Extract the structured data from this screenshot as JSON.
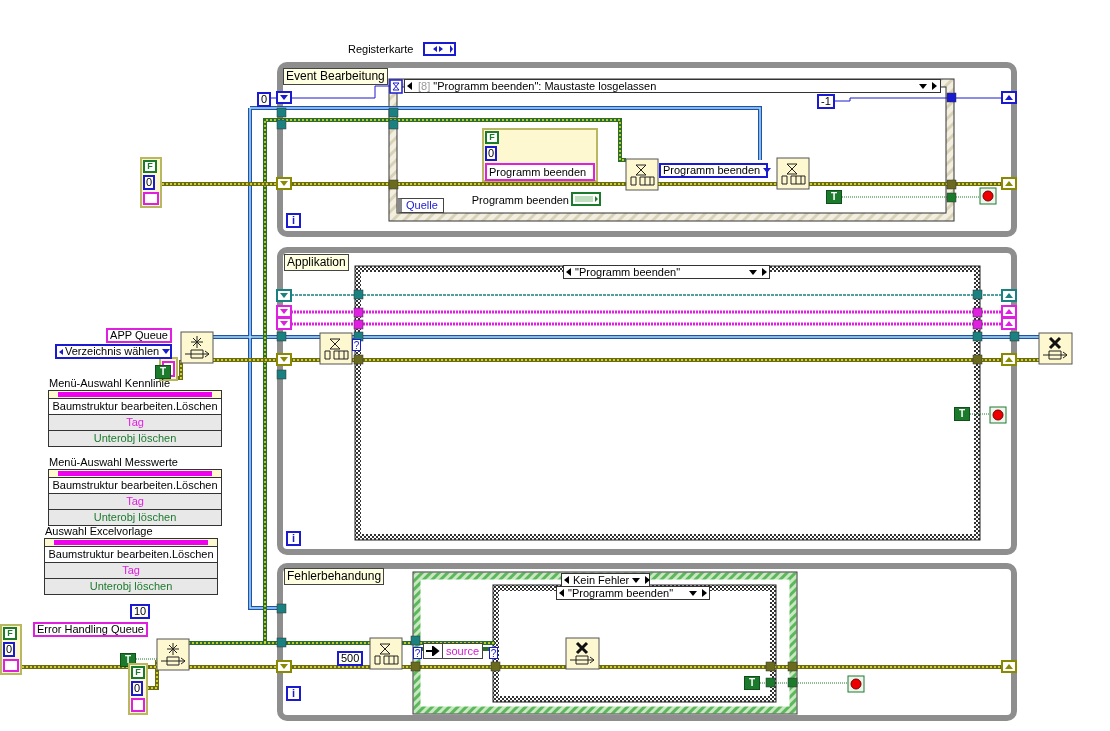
{
  "tab_control": {
    "label": "Registerkarte"
  },
  "loops": [
    {
      "label": "Event Bearbeitung"
    },
    {
      "label": "Applikation"
    },
    {
      "label": "Fehlerbehandung"
    }
  ],
  "iteration_terminals": [
    "i",
    "i",
    "i"
  ],
  "event_structure": {
    "index": "[8]",
    "event": "\"Programm beenden\": Maustaste losgelassen",
    "data_node": "Quelle",
    "control": "Programm beenden"
  },
  "case_selectors": [
    "\"Programm beenden\"",
    "Kein Fehler",
    "\"Programm beenden\""
  ],
  "selector_terminals": [
    "?",
    "?",
    "?"
  ],
  "numeric_constants": [
    "0",
    "-1",
    "10",
    "500"
  ],
  "boolean_constants": [
    "T",
    "T",
    "T",
    "T",
    "T"
  ],
  "string_constants": [
    "APP Queue",
    "Error Handling Queue"
  ],
  "enum_constants": [
    "Programm beenden",
    "Verzeichnis wählen"
  ],
  "error_clusters": [
    {
      "status": "F",
      "code": "0",
      "source": "Programm beenden"
    },
    {
      "status": "F",
      "code": "0"
    },
    {
      "status": "F",
      "code": "0"
    },
    {
      "status": "F",
      "code": "0"
    }
  ],
  "unbundle": {
    "element": "source"
  },
  "menu_clusters": [
    {
      "title": "Menü-Auswahl Kennlinie",
      "rows": [
        "Baumstruktur bearbeiten.Löschen",
        "Tag",
        "Unterobj löschen"
      ]
    },
    {
      "title": "Menü-Auswahl Messwerte",
      "rows": [
        "Baumstruktur bearbeiten.Löschen",
        "Tag",
        "Unterobj löschen"
      ]
    },
    {
      "title": "Auswahl Excelvorlage",
      "rows": [
        "Baumstruktur bearbeiten.Löschen",
        "Tag",
        "Unterobj löschen"
      ]
    }
  ]
}
